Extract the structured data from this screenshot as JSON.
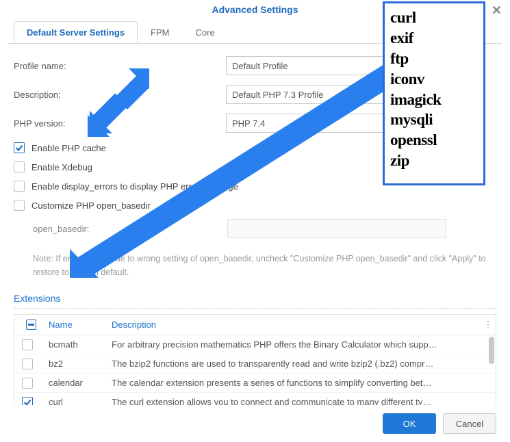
{
  "title": "Advanced Settings",
  "tabs": [
    "Default Server Settings",
    "FPM",
    "Core"
  ],
  "form": {
    "profile_name_label": "Profile name:",
    "profile_name_value": "Default Profile",
    "description_label": "Description:",
    "description_value": "Default PHP 7.3 Profile",
    "php_version_label": "PHP version:",
    "php_version_value": "PHP 7.4",
    "enable_cache": "Enable PHP cache",
    "enable_xdebug": "Enable Xdebug",
    "enable_display_errors": "Enable display_errors to display PHP error message",
    "customize_basedir": "Customize PHP open_basedir",
    "open_basedir_label": "open_basedir:",
    "note": "Note: If errors occur due to wrong setting of open_basedir, uncheck \"Customize PHP open_basedir\" and click \"Apply\" to restore to system default."
  },
  "extensions_title": "Extensions",
  "table": {
    "col_name": "Name",
    "col_desc": "Description",
    "rows": [
      {
        "checked": false,
        "name": "bcmath",
        "desc": "For arbitrary precision mathematics PHP offers the Binary Calculator which supp…"
      },
      {
        "checked": false,
        "name": "bz2",
        "desc": "The bzip2 functions are used to transparently read and write bzip2 (.bz2) compr…"
      },
      {
        "checked": false,
        "name": "calendar",
        "desc": "The calendar extension presents a series of functions to simplify converting bet…"
      },
      {
        "checked": true,
        "name": "curl",
        "desc": "The curl extension allows you to connect and communicate to many different ty…"
      }
    ]
  },
  "overlay_list": [
    "curl",
    "exif",
    "ftp",
    "iconv",
    "imagick",
    "mysqli",
    "openssl",
    "zip"
  ],
  "buttons": {
    "ok": "OK",
    "cancel": "Cancel"
  }
}
